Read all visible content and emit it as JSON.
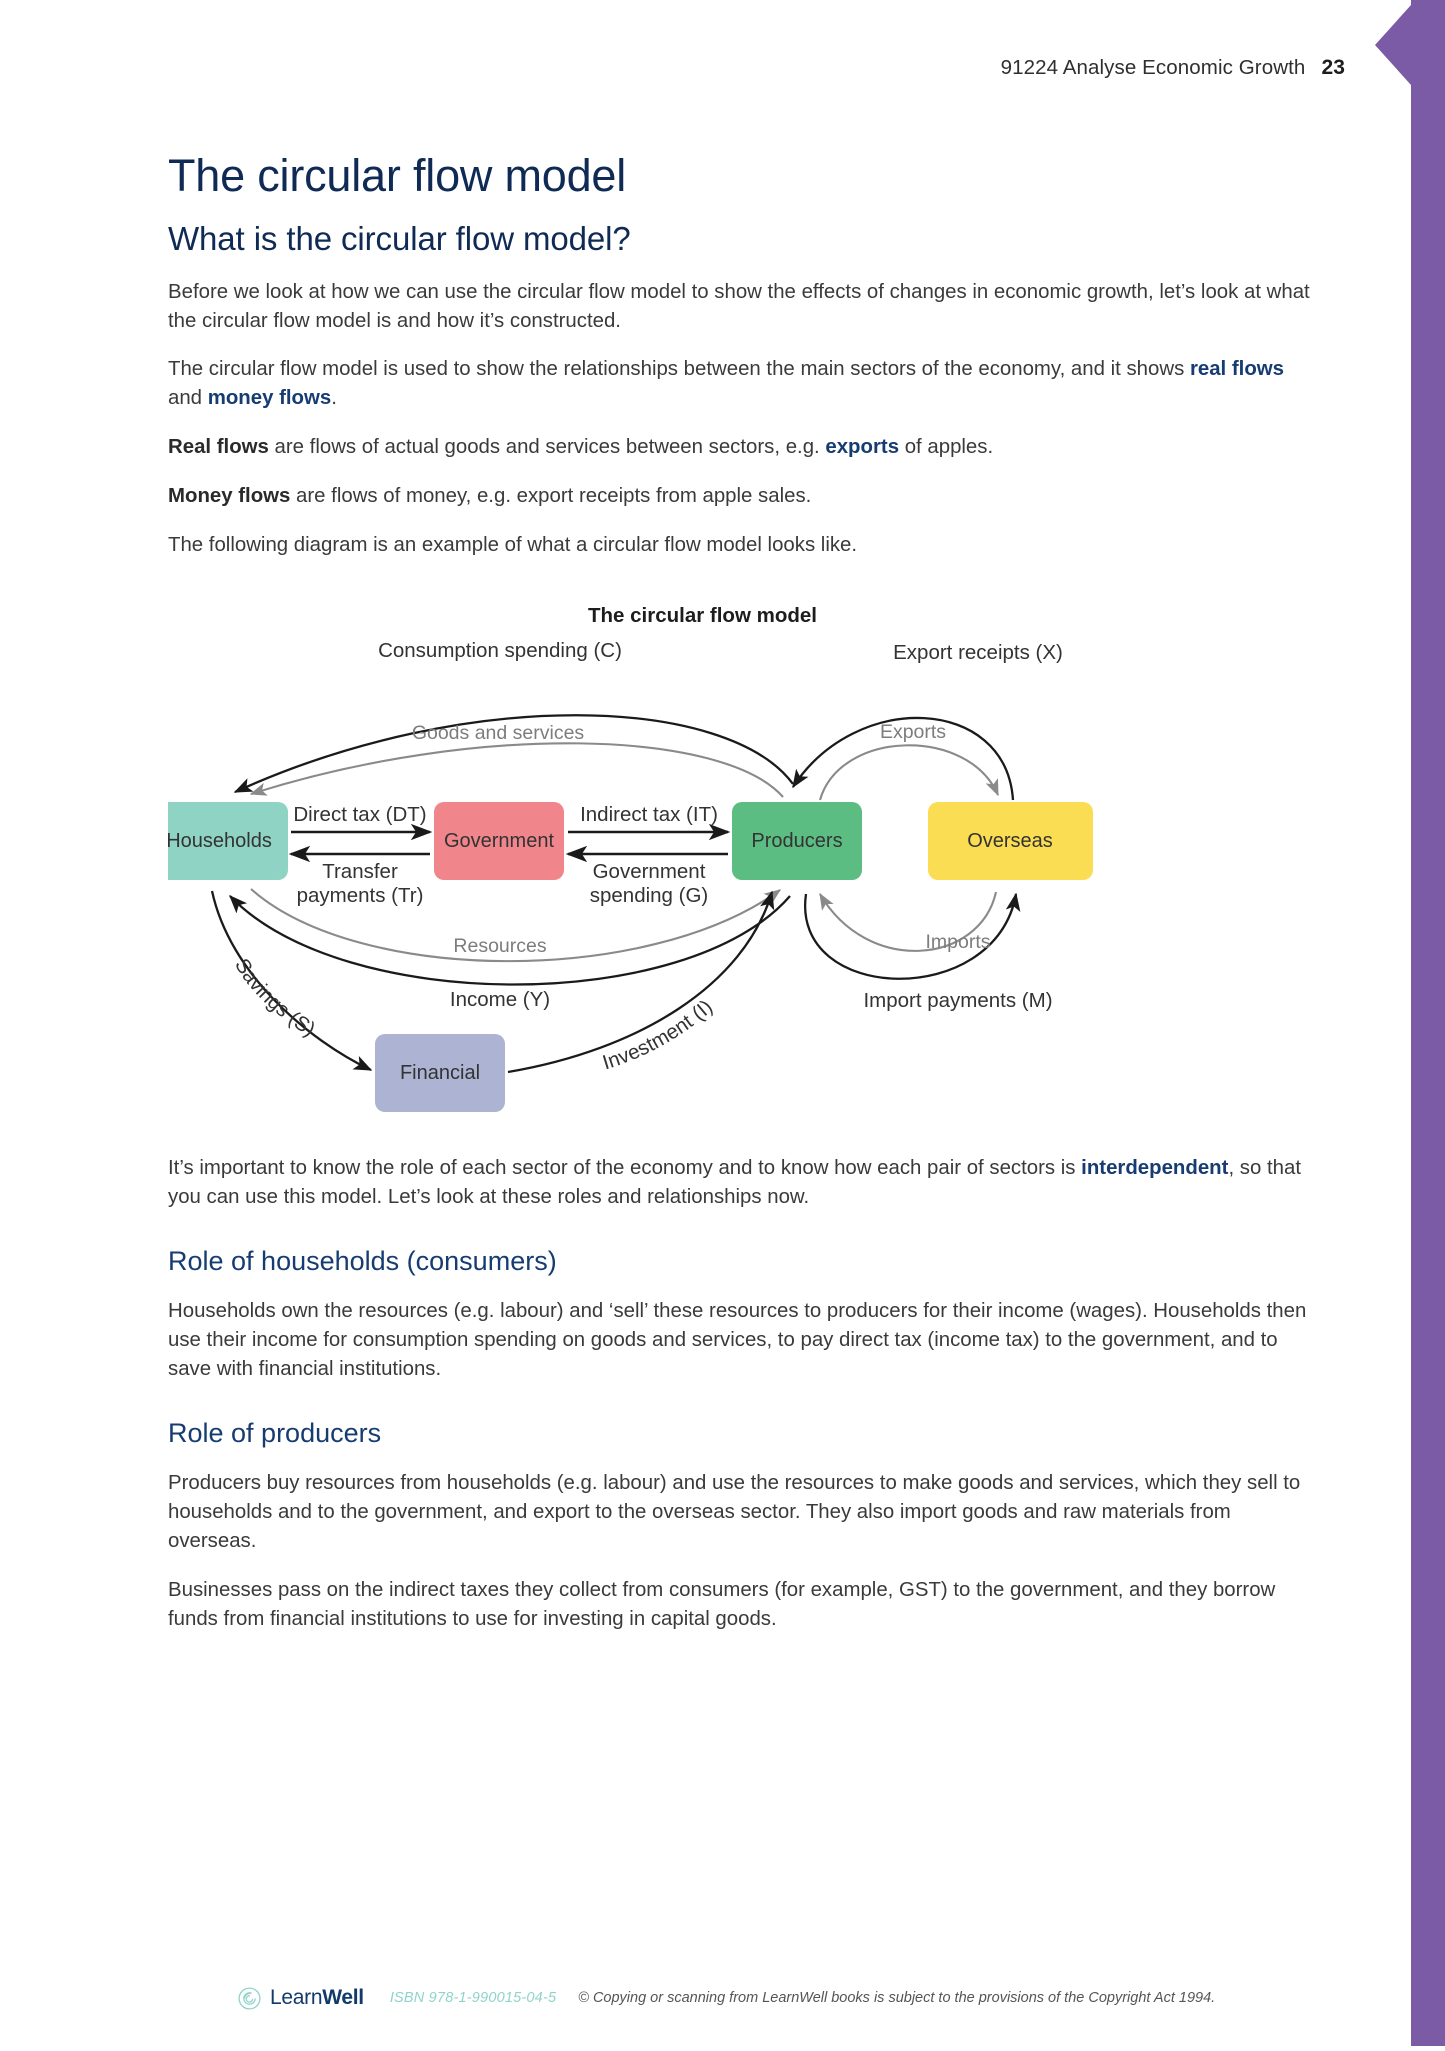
{
  "running_head": {
    "standard": "91224 Analyse Economic Growth",
    "page_number": "23"
  },
  "page_title": "The circular flow model",
  "section_heading": "What is the circular flow model?",
  "paragraphs": {
    "intro": "Before we look at how we can use the circular flow model to show the effects of changes in economic growth, let’s look at what the circular flow model is and how it’s constructed.",
    "p2_a": "The circular flow model is used to show the relationships between the main sectors of the economy, and it shows ",
    "p2_b": "real flows",
    "p2_c": " and ",
    "p2_d": "money flows",
    "p2_e": ".",
    "p3_a": "Real flows",
    "p3_b": " are flows of actual goods and services between sectors, e.g. ",
    "p3_c": "exports",
    "p3_d": " of apples.",
    "p4_a": "Money flows",
    "p4_b": " are flows of money, e.g. export receipts from apple sales.",
    "p5": "The following diagram is an example of what a circular flow model looks like.",
    "p6_a": "It’s important to know the role of each sector of the economy and to know how each pair of sectors is ",
    "p6_b": "interdependent",
    "p6_c": ", so that you can use this model. Let’s look at these roles and relationships now."
  },
  "subsections": [
    {
      "heading": "Role of households (consumers)",
      "body": [
        "Households own the resources (e.g. labour) and ‘sell’ these resources to producers for their income (wages). Households then use their income for consumption spending on goods and services, to pay direct tax (income tax) to the government, and to save with financial institutions."
      ]
    },
    {
      "heading": "Role of producers",
      "body": [
        "Producers buy resources from households (e.g. labour) and use the resources to make goods and services, which they sell to households and to the government, and export to the overseas sector. They also import goods and raw materials from overseas.",
        "Businesses pass on the indirect taxes they collect from consumers (for example, GST) to the government, and they borrow funds from financial institutions to use for investing in capital goods."
      ]
    }
  ],
  "diagram": {
    "title": "The circular flow model",
    "sectors": [
      {
        "id": "households",
        "label": "Households",
        "color": "#8ed3c4"
      },
      {
        "id": "government",
        "label": "Government",
        "color": "#f0868c"
      },
      {
        "id": "producers",
        "label": "Producers",
        "color": "#5cbd82"
      },
      {
        "id": "overseas",
        "label": "Overseas",
        "color": "#fbdd54"
      },
      {
        "id": "financial",
        "label": "Financial",
        "color": "#adb4d3"
      }
    ],
    "money_flow_color": "#1a1a1a",
    "real_flow_color": "#8a8a8a",
    "flows": [
      {
        "label": "Consumption spending (C)",
        "from": "households",
        "to": "producers",
        "kind": "money"
      },
      {
        "label": "Goods and services",
        "from": "producers",
        "to": "households",
        "kind": "real"
      },
      {
        "label": "Export receipts (X)",
        "from": "overseas",
        "to": "producers",
        "kind": "money"
      },
      {
        "label": "Exports",
        "from": "producers",
        "to": "overseas",
        "kind": "real"
      },
      {
        "label": "Direct tax (DT)",
        "from": "households",
        "to": "government",
        "kind": "money"
      },
      {
        "label": "Transfer payments (Tr)",
        "from": "government",
        "to": "households",
        "kind": "money"
      },
      {
        "label": "Indirect tax (IT)",
        "from": "producers",
        "to": "government",
        "kind": "money"
      },
      {
        "label": "Government spending (G)",
        "from": "government",
        "to": "producers",
        "kind": "money"
      },
      {
        "label": "Resources",
        "from": "households",
        "to": "producers",
        "kind": "real"
      },
      {
        "label": "Income (Y)",
        "from": "producers",
        "to": "households",
        "kind": "money"
      },
      {
        "label": "Savings (S)",
        "from": "households",
        "to": "financial",
        "kind": "money"
      },
      {
        "label": "Investment (I)",
        "from": "financial",
        "to": "producers",
        "kind": "money"
      },
      {
        "label": "Imports",
        "from": "overseas",
        "to": "producers",
        "kind": "real"
      },
      {
        "label": "Import payments (M)",
        "from": "producers",
        "to": "overseas",
        "kind": "money"
      }
    ],
    "labels": {
      "consumption": "Consumption spending (C)",
      "goods_services": "Goods and services",
      "export_receipts": "Export receipts (X)",
      "exports": "Exports",
      "direct_tax": "Direct tax (DT)",
      "transfer_1": "Transfer",
      "transfer_2": "payments (Tr)",
      "indirect_tax": "Indirect tax (IT)",
      "govt_spend_1": "Government",
      "govt_spend_2": "spending (G)",
      "resources": "Resources",
      "income": "Income (Y)",
      "savings": "Savings (S)",
      "investment": "Investment (I)",
      "imports": "Imports",
      "import_payments": "Import payments (M)"
    }
  },
  "footer": {
    "brand_learn": "Learn",
    "brand_well": "Well",
    "isbn": "ISBN 978-1-990015-04-5",
    "copyright": "© Copying or scanning from LearnWell books is subject to the provisions of the Copyright Act 1994."
  },
  "colors": {
    "accent_purple": "#7b5ba6",
    "heading_navy": "#0f2a54",
    "sub_navy": "#173c72",
    "logo_teal": "#8fd3cb"
  }
}
